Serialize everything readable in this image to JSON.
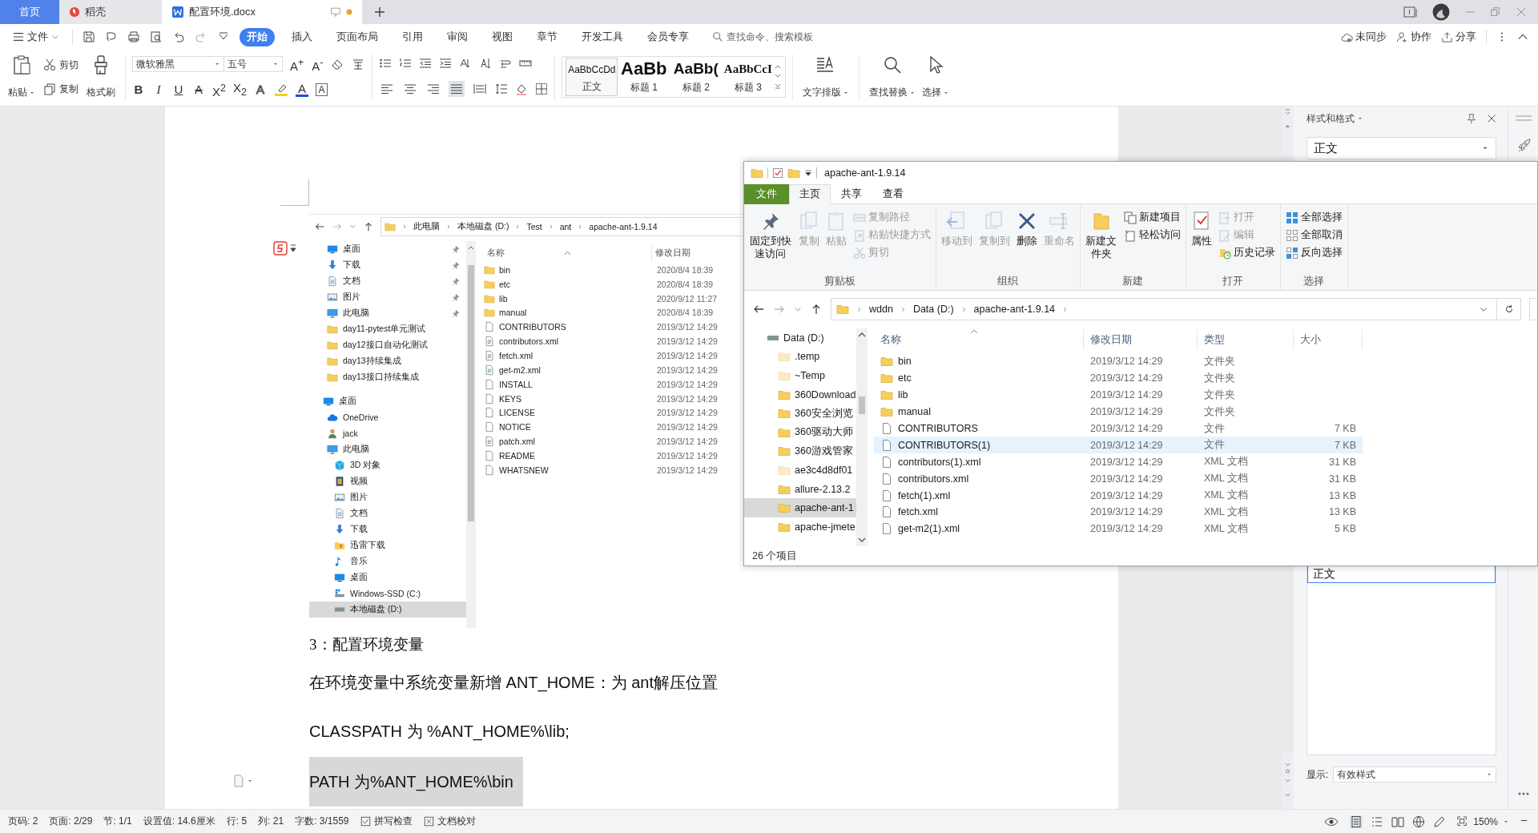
{
  "title_bar": {
    "tabs": [
      {
        "label": "首页",
        "kind": "home",
        "selected": false
      },
      {
        "label": "稻壳",
        "kind": "docer",
        "selected": false
      },
      {
        "label": "配置环境.docx",
        "kind": "document",
        "selected": true
      }
    ]
  },
  "menu_bar": {
    "file_menu": "文件",
    "items": [
      {
        "label": "开始",
        "selected": true
      },
      {
        "label": "插入",
        "selected": false
      },
      {
        "label": "页面布局",
        "selected": false
      },
      {
        "label": "引用",
        "selected": false
      },
      {
        "label": "审阅",
        "selected": false
      },
      {
        "label": "视图",
        "selected": false
      },
      {
        "label": "章节",
        "selected": false
      },
      {
        "label": "开发工具",
        "selected": false
      },
      {
        "label": "会员专享",
        "selected": false
      }
    ],
    "search": {
      "placeholder": "查找命令、搜索模板"
    },
    "actions": [
      {
        "label": "未同步",
        "kind": "cloud"
      },
      {
        "label": "协作",
        "kind": "people"
      },
      {
        "label": "分享",
        "kind": "share"
      }
    ]
  },
  "ribbon": {
    "clipboard": {
      "paste": "粘贴",
      "cut": "剪切",
      "copy": "复制",
      "format_painter": "格式刷"
    },
    "font": {
      "name": "微软雅黑",
      "size": "五号",
      "size_buttons": [
        "A$^{+}$",
        "A$^{-}$"
      ],
      "format_buttons": [
        {
          "glyph": "B",
          "kind": "bold"
        },
        {
          "glyph": "I",
          "kind": "italic"
        },
        {
          "glyph": "U",
          "kind": "underline"
        },
        {
          "glyph": "A",
          "kind": "strike"
        },
        {
          "glyph": "X$^{2}$",
          "kind": "plain"
        },
        {
          "glyph": "X$_{2}$",
          "kind": "plain"
        },
        {
          "glyph": "A",
          "kind": "outline"
        },
        {
          "glyph": "A",
          "kind": "color",
          "color": "#1f4fd6"
        },
        {
          "glyph": "A",
          "kind": "boxed"
        }
      ]
    },
    "paragraph": {
      "align_buttons": [
        {
          "kind": "left",
          "selected": false
        },
        {
          "kind": "center",
          "selected": false
        },
        {
          "kind": "right",
          "selected": false
        },
        {
          "kind": "justify",
          "selected": true
        },
        {
          "kind": "distributed",
          "selected": false
        }
      ]
    },
    "styles": [
      {
        "sample": "AaBbCcDd",
        "label": "正文",
        "kind": "body",
        "selected": true
      },
      {
        "sample": "AaBb",
        "label": "标题 1",
        "kind": "h1",
        "selected": false
      },
      {
        "sample": "AaBb(",
        "label": "标题 2",
        "kind": "h2",
        "selected": false
      },
      {
        "sample": "AaBbCcI",
        "label": "标题 3",
        "kind": "h3",
        "selected": false
      }
    ],
    "tools": [
      {
        "label": "文字排版",
        "kind": "layout"
      },
      {
        "label": "查找替换",
        "kind": "find"
      },
      {
        "label": "选择",
        "kind": "select"
      }
    ]
  },
  "document": {
    "screenshot": {
      "breadcrumb": [
        "此电脑",
        "本地磁盘 (D:)",
        "Test",
        "ant",
        "apache-ant-1.9.14"
      ],
      "quick_access": [
        {
          "label": "桌面",
          "kind": "desktop",
          "pinned": true
        },
        {
          "label": "下载",
          "kind": "download",
          "pinned": true
        },
        {
          "label": "文档",
          "kind": "doc",
          "pinned": true
        },
        {
          "label": "图片",
          "kind": "picture",
          "pinned": true
        },
        {
          "label": "此电脑",
          "kind": "pc",
          "pinned": true
        },
        {
          "label": "day11-pytest单元测试",
          "kind": "folder",
          "pinned": false
        },
        {
          "label": "day12接口自动化测试",
          "kind": "folder",
          "pinned": false
        },
        {
          "label": "day13持续集成",
          "kind": "folder",
          "pinned": false
        },
        {
          "label": "day13接口持续集成",
          "kind": "folder",
          "pinned": false
        }
      ],
      "tree": [
        {
          "label": "桌面",
          "kind": "desktop",
          "selected": false,
          "children": [
            {
              "label": "OneDrive",
              "kind": "cloud",
              "selected": false
            },
            {
              "label": "jack",
              "kind": "user",
              "selected": false
            },
            {
              "label": "此电脑",
              "kind": "pc",
              "selected": false,
              "children": [
                {
                  "label": "3D 对象",
                  "kind": "cube",
                  "selected": false
                },
                {
                  "label": "视频",
                  "kind": "video",
                  "selected": false
                },
                {
                  "label": "图片",
                  "kind": "picture",
                  "selected": false
                },
                {
                  "label": "文档",
                  "kind": "doc",
                  "selected": false
                },
                {
                  "label": "下载",
                  "kind": "download",
                  "selected": false
                },
                {
                  "label": "迅雷下载",
                  "kind": "thunder",
                  "selected": false
                },
                {
                  "label": "音乐",
                  "kind": "music",
                  "selected": false
                },
                {
                  "label": "桌面",
                  "kind": "desktop",
                  "selected": false
                },
                {
                  "label": "Windows-SSD (C:)",
                  "kind": "windrive",
                  "selected": false
                },
                {
                  "label": "本地磁盘 (D:)",
                  "kind": "drive",
                  "selected": true
                }
              ]
            }
          ]
        }
      ],
      "columns": [
        "名称",
        "修改日期"
      ],
      "files": [
        {
          "name": "bin",
          "kind": "folder",
          "date": "2020/8/4 18:39"
        },
        {
          "name": "etc",
          "kind": "folder",
          "date": "2020/8/4 18:39"
        },
        {
          "name": "lib",
          "kind": "folder",
          "date": "2020/9/12 11:27"
        },
        {
          "name": "manual",
          "kind": "folder",
          "date": "2020/8/4 18:39"
        },
        {
          "name": "CONTRIBUTORS",
          "kind": "file",
          "date": "2019/3/12 14:29"
        },
        {
          "name": "contributors.xml",
          "kind": "xml",
          "date": "2019/3/12 14:29"
        },
        {
          "name": "fetch.xml",
          "kind": "xml",
          "date": "2019/3/12 14:29"
        },
        {
          "name": "get-m2.xml",
          "kind": "xml",
          "date": "2019/3/12 14:29"
        },
        {
          "name": "INSTALL",
          "kind": "file",
          "date": "2019/3/12 14:29"
        },
        {
          "name": "KEYS",
          "kind": "file",
          "date": "2019/3/12 14:29"
        },
        {
          "name": "LICENSE",
          "kind": "file",
          "date": "2019/3/12 14:29"
        },
        {
          "name": "NOTICE",
          "kind": "file",
          "date": "2019/3/12 14:29"
        },
        {
          "name": "patch.xml",
          "kind": "xml",
          "date": "2019/3/12 14:29"
        },
        {
          "name": "README",
          "kind": "file",
          "date": "2019/3/12 14:29"
        },
        {
          "name": "WHATSNEW",
          "kind": "file",
          "date": "2019/3/12 14:29"
        }
      ]
    },
    "paragraphs": [
      {
        "text": "3：配置环境变量",
        "kind": "heading",
        "highlighted": false
      },
      {
        "text": "在环境变量中系统变量新增 ANT_HOME：为 ant解压位置",
        "kind": "body",
        "highlighted": false
      },
      {
        "text": "CLASSPATH 为 %ANT_HOME%\\lib;",
        "kind": "body",
        "highlighted": false
      },
      {
        "text": "PATH 为%ANT_HOME%\\bin",
        "kind": "body",
        "highlighted": true
      }
    ]
  },
  "right_panel": {
    "title": "样式和格式",
    "current_style": "正文",
    "style_list": [
      {
        "label": "正文",
        "selected": true
      }
    ],
    "show_label": "显示:",
    "show_value": "有效样式"
  },
  "explorer": {
    "title": "apache-ant-1.9.14",
    "tabs": [
      {
        "label": "文件",
        "kind": "file",
        "selected": false
      },
      {
        "label": "主页",
        "kind": "tab",
        "selected": true
      },
      {
        "label": "共享",
        "kind": "tab",
        "selected": false
      },
      {
        "label": "查看",
        "kind": "tab",
        "selected": false
      }
    ],
    "groups": [
      {
        "label": "剪贴板",
        "commands": [
          {
            "label": "固定到快速访问",
            "kind": "pin",
            "disabled": false
          },
          {
            "label": "复制",
            "kind": "copy",
            "disabled": true
          },
          {
            "label": "粘贴",
            "kind": "paste",
            "disabled": true
          },
          {
            "label": "复制路径",
            "kind": "copypath",
            "disabled": true
          },
          {
            "label": "粘贴快捷方式",
            "kind": "shortcut",
            "disabled": true
          },
          {
            "label": "剪切",
            "kind": "cut",
            "disabled": true
          }
        ]
      },
      {
        "label": "组织",
        "commands": [
          {
            "label": "移动到",
            "kind": "moveto",
            "disabled": true
          },
          {
            "label": "复制到",
            "kind": "copyto",
            "disabled": true
          },
          {
            "label": "删除",
            "kind": "delete",
            "disabled": false
          },
          {
            "label": "重命名",
            "kind": "rename",
            "disabled": true
          }
        ]
      },
      {
        "label": "新建",
        "commands": [
          {
            "label": "新建文件夹",
            "kind": "newfolder",
            "disabled": false
          },
          {
            "label": "新建项目",
            "kind": "newitem",
            "disabled": false
          },
          {
            "label": "轻松访问",
            "kind": "easyaccess",
            "disabled": false
          }
        ]
      },
      {
        "label": "打开",
        "commands": [
          {
            "label": "属性",
            "kind": "properties",
            "disabled": false
          },
          {
            "label": "打开",
            "kind": "open",
            "disabled": true
          },
          {
            "label": "编辑",
            "kind": "edit",
            "disabled": true
          },
          {
            "label": "历史记录",
            "kind": "history",
            "disabled": false
          }
        ]
      },
      {
        "label": "选择",
        "commands": [
          {
            "label": "全部选择",
            "kind": "selectall",
            "disabled": false
          },
          {
            "label": "全部取消",
            "kind": "selectnone",
            "disabled": false
          },
          {
            "label": "反向选择",
            "kind": "invert",
            "disabled": false
          }
        ]
      }
    ],
    "address": [
      "wddn",
      "Data (D:)",
      "apache-ant-1.9.14"
    ],
    "nav": [
      {
        "label": "Data (D:)",
        "kind": "drive",
        "hidden": false,
        "selected": false,
        "children": [
          {
            "label": ".temp",
            "kind": "folder",
            "hidden": true,
            "selected": false
          },
          {
            "label": "~Temp",
            "kind": "folder",
            "hidden": true,
            "selected": false
          },
          {
            "label": "360Download",
            "kind": "folder",
            "hidden": false,
            "selected": false
          },
          {
            "label": "360安全浏览",
            "kind": "folder",
            "hidden": false,
            "selected": false
          },
          {
            "label": "360驱动大师",
            "kind": "folder",
            "hidden": false,
            "selected": false
          },
          {
            "label": "360游戏管家",
            "kind": "folder",
            "hidden": false,
            "selected": false
          },
          {
            "label": "ae3c4d8df01",
            "kind": "folder",
            "hidden": true,
            "selected": false
          },
          {
            "label": "allure-2.13.2",
            "kind": "folder",
            "hidden": false,
            "selected": false
          },
          {
            "label": "apache-ant-1",
            "kind": "folder",
            "hidden": false,
            "selected": true
          },
          {
            "label": "apache-jmete",
            "kind": "folder",
            "hidden": false,
            "selected": false
          }
        ]
      }
    ],
    "columns": [
      "名称",
      "修改日期",
      "类型",
      "大小"
    ],
    "files": [
      {
        "name": "bin",
        "kind": "folder",
        "date": "2019/3/12 14:29",
        "type": "文件夹",
        "selected": false
      },
      {
        "name": "etc",
        "kind": "folder",
        "date": "2019/3/12 14:29",
        "type": "文件夹",
        "selected": false
      },
      {
        "name": "lib",
        "kind": "folder",
        "date": "2019/3/12 14:29",
        "type": "文件夹",
        "selected": false
      },
      {
        "name": "manual",
        "kind": "folder",
        "date": "2019/3/12 14:29",
        "type": "文件夹",
        "selected": false
      },
      {
        "name": "CONTRIBUTORS",
        "kind": "file",
        "date": "2019/3/12 14:29",
        "type": "文件",
        "size": "7 KB",
        "selected": false
      },
      {
        "name": "CONTRIBUTORS(1)",
        "kind": "file",
        "date": "2019/3/12 14:29",
        "type": "文件",
        "size": "7 KB",
        "selected": true
      },
      {
        "name": "contributors(1).xml",
        "kind": "file",
        "date": "2019/3/12 14:29",
        "type": "XML 文档",
        "size": "31 KB",
        "selected": false
      },
      {
        "name": "contributors.xml",
        "kind": "file",
        "date": "2019/3/12 14:29",
        "type": "XML 文档",
        "size": "31 KB",
        "selected": false
      },
      {
        "name": "fetch(1).xml",
        "kind": "file",
        "date": "2019/3/12 14:29",
        "type": "XML 文档",
        "size": "13 KB",
        "selected": false
      },
      {
        "name": "fetch.xml",
        "kind": "file",
        "date": "2019/3/12 14:29",
        "type": "XML 文档",
        "size": "13 KB",
        "selected": false
      },
      {
        "name": "get-m2(1).xml",
        "kind": "file",
        "date": "2019/3/12 14:29",
        "type": "XML 文档",
        "size": "5 KB",
        "selected": false
      }
    ],
    "status": "26 个项目"
  },
  "status_bar": {
    "items": [
      "页码: 2",
      "页面: 2/29",
      "节: 1/1",
      "设置值: 14.6厘米",
      "行: 5",
      "列: 21",
      "字数: 3/1559"
    ],
    "checks": [
      {
        "label": "拼写检查",
        "kind": "spell"
      },
      {
        "label": "文档校对",
        "kind": "proof"
      }
    ],
    "zoom": "150%"
  }
}
